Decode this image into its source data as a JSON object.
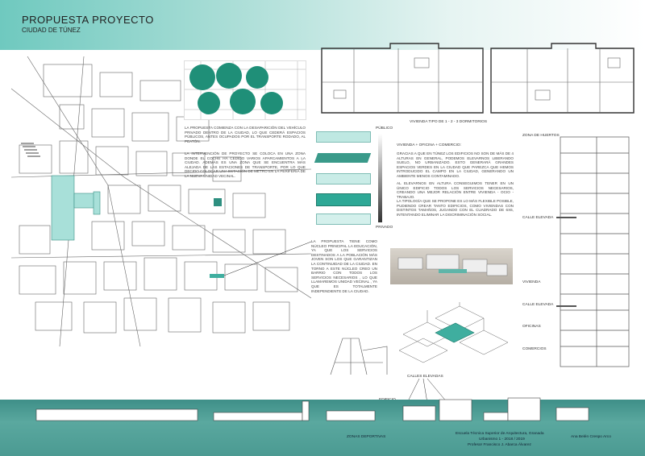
{
  "header": {
    "title": "PROPUESTA PROYECTO",
    "subtitle": "CIUDAD DE TÚNEZ"
  },
  "left_texts": {
    "p1": "LA PROPUESTA COMIENZA CON LA DESAPARICIÓN DEL VEHÍCULO PRIVADO DENTRO DE LA CIUDAD, LO QUE CEDERÁ ESPACIOS PÚBLICOS, ANTES OCUPADOS POR EL TRANSPORTE RODADO, AL PEATÓN.",
    "p2": "LA INTERVENCIÓN DE PROYECTO SE COLOCA EN UNA ZONA DONDE EL COCHE HA CEDIDO VARIOS APARCAMIENTOS A LA CIUDAD. ADEMÁS ES UNA ZONA QUE SE ENCUENTRA MÁS ALEJADA DE LAS ESTACIONES DE TRANSPORTE, POR LO QUE DECIDO COLOCAR UNA ESTACIÓN DE METRO EN LA PERIFERIA DE LA NUEVA UNIDAD VECINAL.",
    "p3": "LA PROPUESTA TIENE COMO NÚCLEO PRINCIPAL LA EDUCACIÓN, YA QUE LOS SERVICIOS DESTINADOS A LA POBLACIÓN MÁS JOVEN SON LOS QUE GARANTIZAN LA CONTINUIDAD DE LA CIUDAD. EN TORNO A ESTE NÚCLEO CREO UN BARRIO CON TODOS LOS SERVICIOS NECESARIOS , LO QUE LLAMAREMOS UNIDAD VECINAL , YA QUE ES TOTALMENTE INDEPENDIENTE DE LA CIUDAD."
  },
  "center": {
    "plan_caption": "VIVIENDA TIPO DE 1 - 2 - 3 DORMITORIOS",
    "publico": "PÚBLICO",
    "privado": "PRIVADO",
    "heading": "VIVIENDA + OFICINA + COMERCIO:",
    "p1": "GRACIAS A QUE EN TÚNEZ LOS EDIFICIOS NO SON DE MÁS DE 4 ALTURAS EN GENERAL, PODEMOS ELEVARNOS LIBERANDO SUELO, NO URBANIZADO. ESTO GENERARÁ GRANDES ESPACIOS VERDES EN LA CIUDAD QUE PAREZCA QUE HEMOS INTRODUCIDO EL CAMPO EN LA CIUDAD, GENERANDO UN AMBIENTE MENOS CONTAMINADO.",
    "p2": "AL ELEVARNOS EN ALTURA CONSEGUIMOS TENER EN UN ÚNICO EDIFICIO TODOS LOS SERVICIOS NECESARIOS, CREANDO UNA MEJOR RELACIÓN ENTRE VIVIENDA - OCIO - TRABAJO.",
    "p3": "LA TIPOLOGÍA QUE SE PROPONE ES LO MÁS FLEXIBLE POSIBLE, PUDIENDO CREAR TANTO EDIFICIOS, COMO VIVIENDAS CON DISTINTOS TAMAÑOS, JUGANDO CON EL CUADRADO DE 6X6, INTENTANDO ELIMINAR LA DISCRIMINACIÓN SOCIAL."
  },
  "section_labels": {
    "zona_huertos": "ZONA DE HUERTOS",
    "calle_elevada_1": "CALLE ELEVADA",
    "vivienda": "VIVIENDA",
    "calle_elevada_2": "CALLE ELEVADA",
    "oficinas": "OFICINAS",
    "comercios": "COMERCIOS"
  },
  "bottom": {
    "calles_elevadas": "CALLES ELEVADAS",
    "edificio_1": "EDIFICIO",
    "edificio_2": "PARA",
    "edificio_3": "LA",
    "edificio_4": "EDUCACIÓN.",
    "zonas_deportivas": "ZONAS DEPORTIVAS",
    "school_1": "Escuela Técnica Superior de Arquitectura, Granada",
    "school_2": "Urbanismo 1 - 2018 / 2019",
    "school_3": "Profesor Francisco J. Abarca Álvarez",
    "author": "Ana Belén Crespo Arco"
  },
  "colors": {
    "accent": "#3fae9f",
    "accent_light": "#9fd9d1",
    "footer": "#4b9a92"
  }
}
